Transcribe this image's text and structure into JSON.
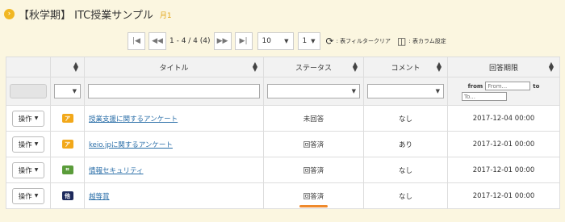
{
  "header": {
    "icon": "chevron-right-icon",
    "title": "【秋学期】 ITC授業サンプル",
    "subtitle": "月1"
  },
  "pager": {
    "count_text": "1 - 4 / 4 (4)",
    "page_size": "10",
    "page": "1",
    "clear_filter": ": 表フィルタークリア",
    "column_setting": ": 表カラム設定"
  },
  "columns": {
    "title": "タイトル",
    "status": "ステータス",
    "comment": "コメント",
    "deadline": "回答期限"
  },
  "filter": {
    "from_label": "from",
    "from_placeholder": "From...",
    "to_label": "to",
    "to_placeholder": "To..."
  },
  "rows": [
    {
      "op": "操作",
      "badge": "ア",
      "badge_color": "#f2a81a",
      "title": "授業支援に関するアンケート",
      "status": "未回答",
      "comment": "なし",
      "deadline": "2017-12-04 00:00"
    },
    {
      "op": "操作",
      "badge": "ア",
      "badge_color": "#f2a81a",
      "title": "keio.jpに関するアンケート",
      "status": "回答済",
      "comment": "あり",
      "deadline": "2017-12-01 00:00"
    },
    {
      "op": "操作",
      "badge": "",
      "badge_color": "#5a9c3a",
      "title": "情報セキュリティ",
      "status": "回答済",
      "comment": "なし",
      "deadline": "2017-12-01 00:00"
    },
    {
      "op": "操作",
      "badge": "他",
      "badge_color": "#1d2a5c",
      "title": "越等賞",
      "status": "回答済",
      "comment": "なし",
      "deadline": "2017-12-01 00:00"
    }
  ],
  "colors": {
    "accent": "#f1b722",
    "link": "#2a6ea8",
    "highlight": "#ef8a2c"
  }
}
